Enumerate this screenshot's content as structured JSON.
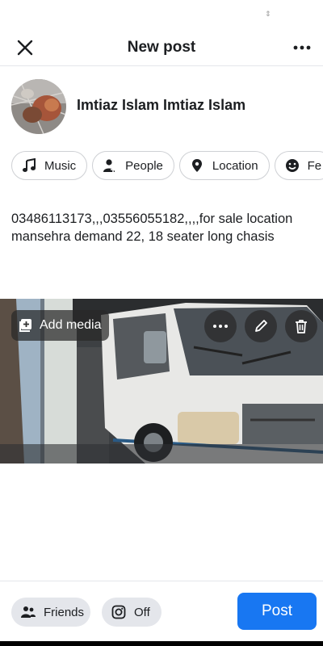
{
  "header": {
    "title": "New post"
  },
  "user": {
    "name": "Imtiaz Islam Imtiaz Islam"
  },
  "chips": [
    {
      "label": "Music",
      "icon": "music-note-icon"
    },
    {
      "label": "People",
      "icon": "people-icon"
    },
    {
      "label": "Location",
      "icon": "location-pin-icon"
    },
    {
      "label": "Fe",
      "icon": "smiley-icon"
    }
  ],
  "post": {
    "text": "03486113173,,,03556055182,,,,for sale location mansehra  demand 22, 18 seater long chasis"
  },
  "media": {
    "add_label": "Add media"
  },
  "footer": {
    "audience_label": "Friends",
    "instagram_label": "Off",
    "post_label": "Post"
  },
  "colors": {
    "accent": "#1877f2",
    "chip_bg": "#e4e6eb"
  }
}
